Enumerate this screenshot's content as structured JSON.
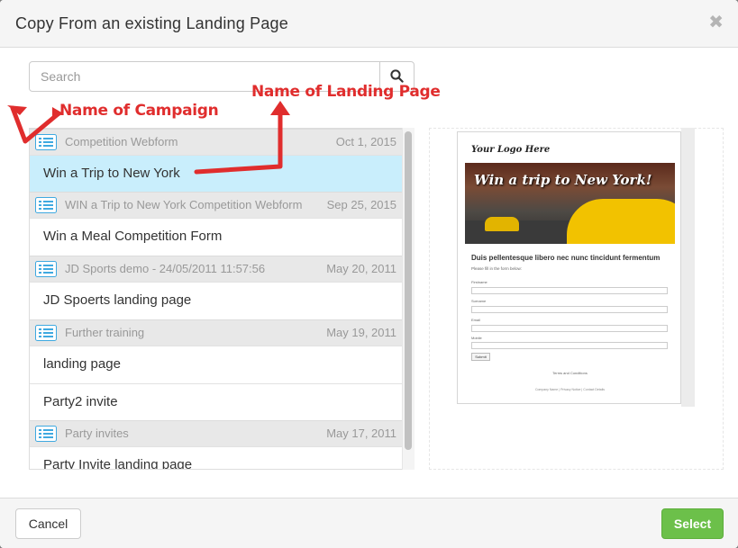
{
  "dialog": {
    "title": "Copy From an existing Landing Page",
    "close_glyph": "✖",
    "cancel_label": "Cancel",
    "select_label": "Select"
  },
  "search": {
    "placeholder": "Search"
  },
  "list": [
    {
      "campaign": "Competition Webform",
      "date": "Oct 1, 2015",
      "pages": [
        "Win a Trip to New York"
      ]
    },
    {
      "campaign": "WIN a Trip to New York Competition Webform",
      "date": "Sep 25, 2015",
      "pages": [
        "Win a Meal Competition Form"
      ]
    },
    {
      "campaign": "JD Sports demo - 24/05/2011 11:57:56",
      "date": "May 20, 2011",
      "pages": [
        "JD Spoerts landing page"
      ]
    },
    {
      "campaign": "Further training",
      "date": "May 19, 2011",
      "pages": [
        "landing page",
        "Party2 invite"
      ]
    },
    {
      "campaign": "Party invites",
      "date": "May 17, 2011",
      "pages": [
        "Party Invite landing page"
      ]
    }
  ],
  "selected_page": "Win a Trip to New York",
  "preview": {
    "logo": "Your Logo Here",
    "banner_headline": "Win a trip to New York!",
    "heading": "Duis pellentesque libero nec nunc tincidunt fermentum",
    "subtext": "Please fill in the form below:",
    "fields": [
      "Firstname",
      "Surname",
      "Email",
      "Mobile"
    ],
    "submit": "Submit",
    "terms": "Terms and Conditions",
    "footer": "Company Name | Privacy Notice | Contact Details"
  },
  "annotations": {
    "campaign": "Name of Campaign",
    "landing_page": "Name of Landing Page"
  },
  "colors": {
    "annotation": "#e02d2d",
    "select_button": "#6cc04a",
    "selected_row": "#c9eefc",
    "campaign_icon": "#3fa9e0"
  }
}
